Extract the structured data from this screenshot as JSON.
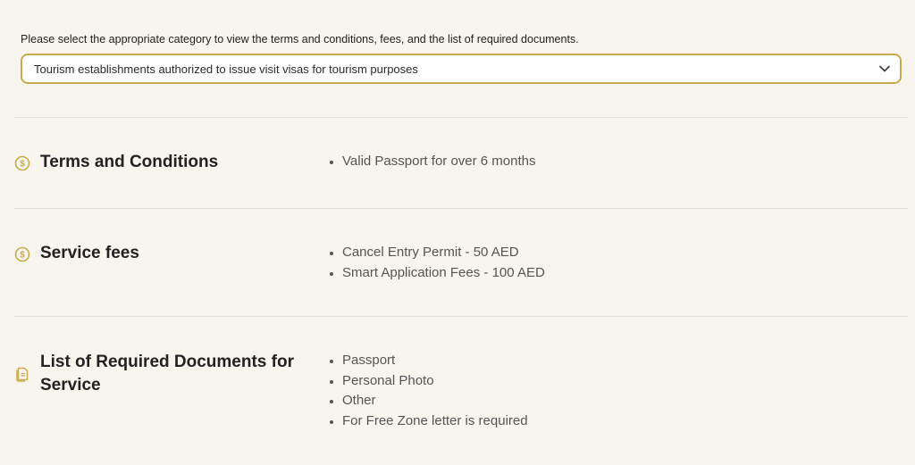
{
  "category": {
    "prompt": "Please select the appropriate category to view the terms and conditions, fees, and the list of required documents.",
    "selected": "Tourism establishments authorized to issue visit visas for tourism purposes"
  },
  "sections": [
    {
      "title": "Terms and Conditions",
      "icon": "dollar-circle-icon",
      "items": [
        "Valid Passport for over 6 months"
      ]
    },
    {
      "title": "Service fees",
      "icon": "dollar-circle-icon",
      "items": [
        "Cancel Entry Permit - 50 AED",
        "Smart Application Fees - 100 AED"
      ]
    },
    {
      "title": "List of Required Documents for Service",
      "icon": "documents-icon",
      "items": [
        "Passport",
        "Personal Photo",
        "Other",
        "For Free Zone letter is required"
      ]
    }
  ],
  "colors": {
    "accent": "#c9ab4e",
    "background": "#f8f5ee"
  }
}
